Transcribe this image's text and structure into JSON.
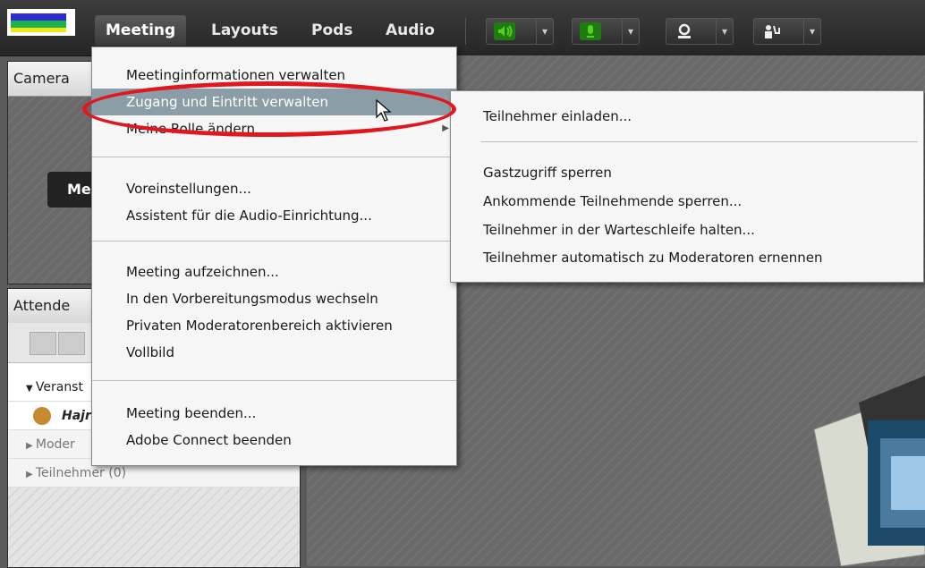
{
  "menubar": {
    "menus": [
      "Meeting",
      "Layouts",
      "Pods",
      "Audio"
    ],
    "active_menu": "Meeting",
    "toolbar_buttons": [
      "speaker-icon",
      "microphone-icon",
      "webcam-icon",
      "raise-hand-icon"
    ]
  },
  "pods": {
    "camera_title": "Camera",
    "camera_button": "Me",
    "attendees_title": "Attende",
    "rows": {
      "veranst": "Veranst",
      "user": "Hajr",
      "moderators": "Moder",
      "participants": "Teilnehmer (0)"
    }
  },
  "meeting_menu": {
    "items": [
      "Meetinginformationen verwalten",
      "Zugang und Eintritt verwalten",
      "Meine Rolle ändern",
      "Voreinstellungen...",
      "Assistent für die Audio-Einrichtung...",
      "Meeting aufzeichnen...",
      "In den Vorbereitungsmodus wechseln",
      "Privaten Moderatorenbereich aktivieren",
      "Vollbild",
      "Meeting beenden...",
      "Adobe Connect beenden"
    ],
    "highlighted": "Zugang und Eintritt verwalten"
  },
  "submenu": {
    "items": [
      "Teilnehmer einladen...",
      "Gastzugriff sperren",
      "Ankommende Teilnehmende sperren...",
      "Teilnehmer in der Warteschleife halten...",
      "Teilnehmer automatisch zu Moderatoren ernennen"
    ]
  },
  "colors": {
    "highlight": "#8b9ea7",
    "annotation": "#e0171f",
    "speaker": "#52d21f",
    "mic": "#52d21f"
  }
}
